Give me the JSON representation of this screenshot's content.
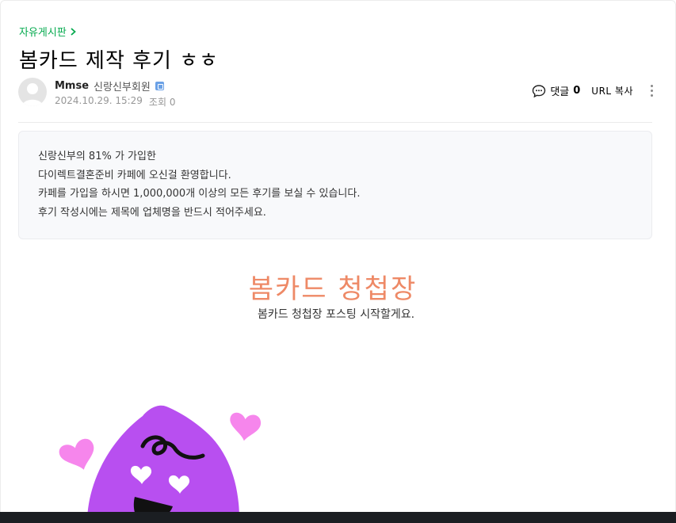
{
  "breadcrumb": {
    "label": "자유게시판"
  },
  "post": {
    "title": "봄카드 제작 후기 ㅎㅎ",
    "author": {
      "name": "Mmse",
      "grade": "신랑신부회원"
    },
    "date": "2024.10.29. 15:29",
    "views_label": "조회 0"
  },
  "actions": {
    "comment_label": "댓글",
    "comment_count": "0",
    "url_copy_label": "URL 복사"
  },
  "notice": {
    "lines": [
      "신랑신부의 81% 가 가입한",
      "다이렉트결혼준비 카페에 오신걸 환영합니다.",
      "카페를 가입을 하시면 1,000,000개 이상의 모든 후기를 보실 수 있습니다.",
      "후기 작성시에는 제목에 업체명을 반드시 적어주세요."
    ]
  },
  "content": {
    "heading": "봄카드 청첩장",
    "subheading": "봄카드 청첩장 포스팅 시작할게요."
  },
  "colors": {
    "breadcrumb_green": "#03a94d",
    "heading_orange": "#ee8966",
    "character_purple": "#b84ff0",
    "heart_pink": "#f686ec"
  },
  "icons": {
    "breadcrumb_arrow": "chevron-right-icon",
    "comment": "speech-bubble-icon",
    "more": "vertical-dots-icon",
    "grade": "grade-badge-icon"
  }
}
